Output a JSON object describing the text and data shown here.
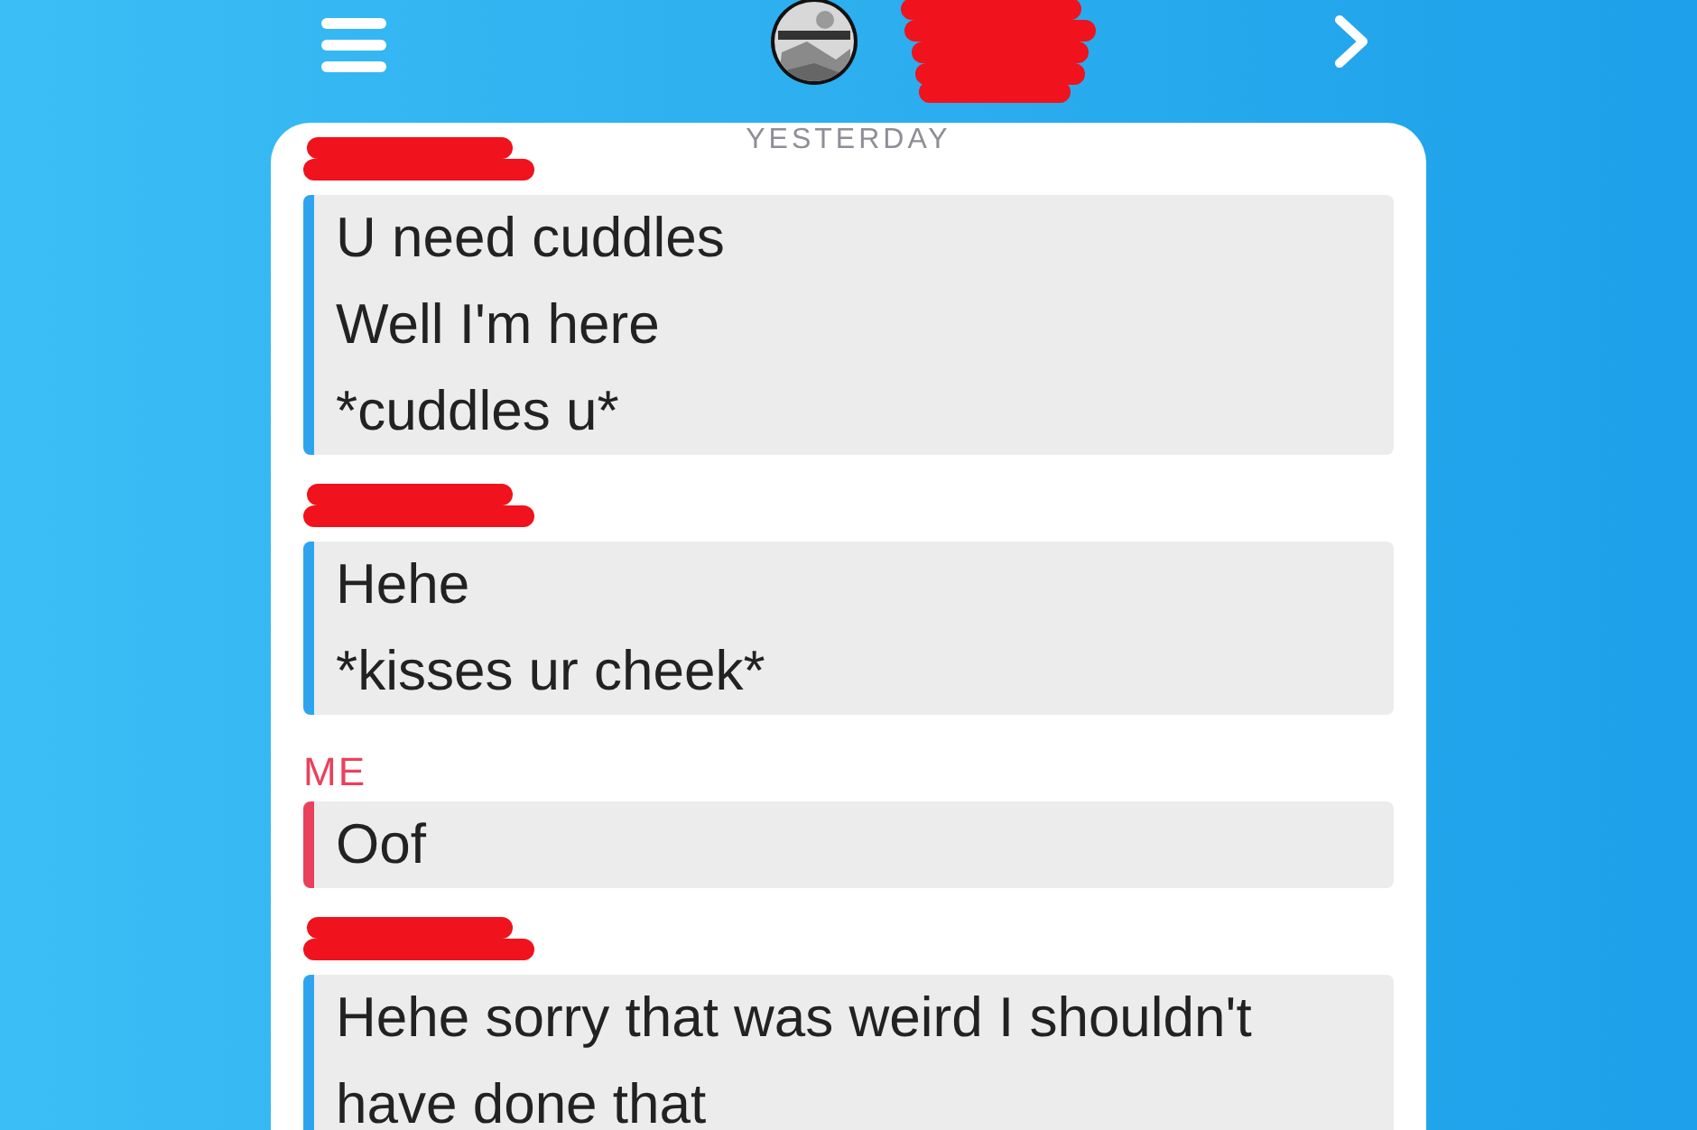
{
  "chat": {
    "date_label": "YESTERDAY",
    "messages": [
      {
        "kind": "received",
        "lines": [
          "U need cuddles",
          "Well I'm here",
          "*cuddles u*"
        ]
      },
      {
        "kind": "received",
        "lines": [
          "Hehe",
          "*kisses ur cheek*"
        ]
      },
      {
        "kind": "sent",
        "sender": "ME",
        "lines": [
          "Oof"
        ]
      },
      {
        "kind": "received",
        "lines": [
          "Hehe sorry that was weird I shouldn't have done that"
        ]
      }
    ]
  }
}
